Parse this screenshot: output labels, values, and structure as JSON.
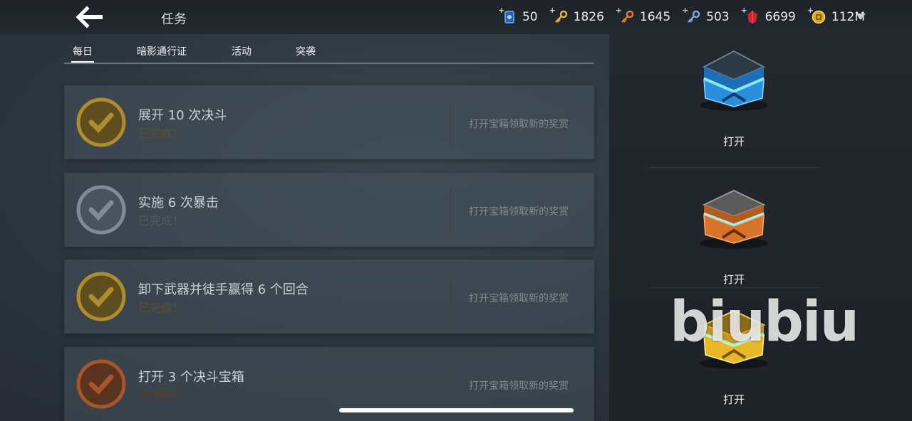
{
  "header": {
    "title": "任务"
  },
  "currencies": [
    {
      "icon": "blue-card-icon",
      "value": "50",
      "color": "#4a8fe0"
    },
    {
      "icon": "gold-key-icon",
      "value": "1826",
      "color": "#e8b23a"
    },
    {
      "icon": "orange-key-icon",
      "value": "1645",
      "color": "#e07a3a"
    },
    {
      "icon": "blue-key-icon",
      "value": "503",
      "color": "#7aa6d8"
    },
    {
      "icon": "red-gem-icon",
      "value": "6699",
      "color": "#d0303a"
    },
    {
      "icon": "gold-coin-icon",
      "value": "112M",
      "color": "#e8c230"
    }
  ],
  "tabs": [
    {
      "label": "每日",
      "active": true
    },
    {
      "label": "暗影通行证",
      "active": false
    },
    {
      "label": "活动",
      "active": false
    },
    {
      "label": "突袭",
      "active": false
    }
  ],
  "quests": [
    {
      "title": "展开 10 次决斗",
      "status": "已完成！",
      "reward": "打开宝箱领取新的奖赏",
      "color": "#c9a132"
    },
    {
      "title": "实施 6 次暴击",
      "status": "已完成！",
      "reward": "打开宝箱领取新的奖赏",
      "color": "#8a96a2"
    },
    {
      "title": "卸下武器并徒手赢得 6 个回合",
      "status": "已完成！",
      "reward": "打开宝箱领取新的奖赏",
      "color": "#c9a132"
    },
    {
      "title": "打开 3 个决斗宝箱",
      "status": "已完成！",
      "reward": "打开宝箱领取新的奖赏",
      "color": "#c0642e"
    }
  ],
  "chests": [
    {
      "icon": "blue-chest-icon",
      "label": "打开",
      "color": "#3fa0e6"
    },
    {
      "icon": "orange-chest-icon",
      "label": "打开",
      "color": "#e0762a"
    },
    {
      "icon": "gold-chest-icon",
      "label": "打开",
      "color": "#e8b828"
    }
  ],
  "watermark": "biubiu"
}
